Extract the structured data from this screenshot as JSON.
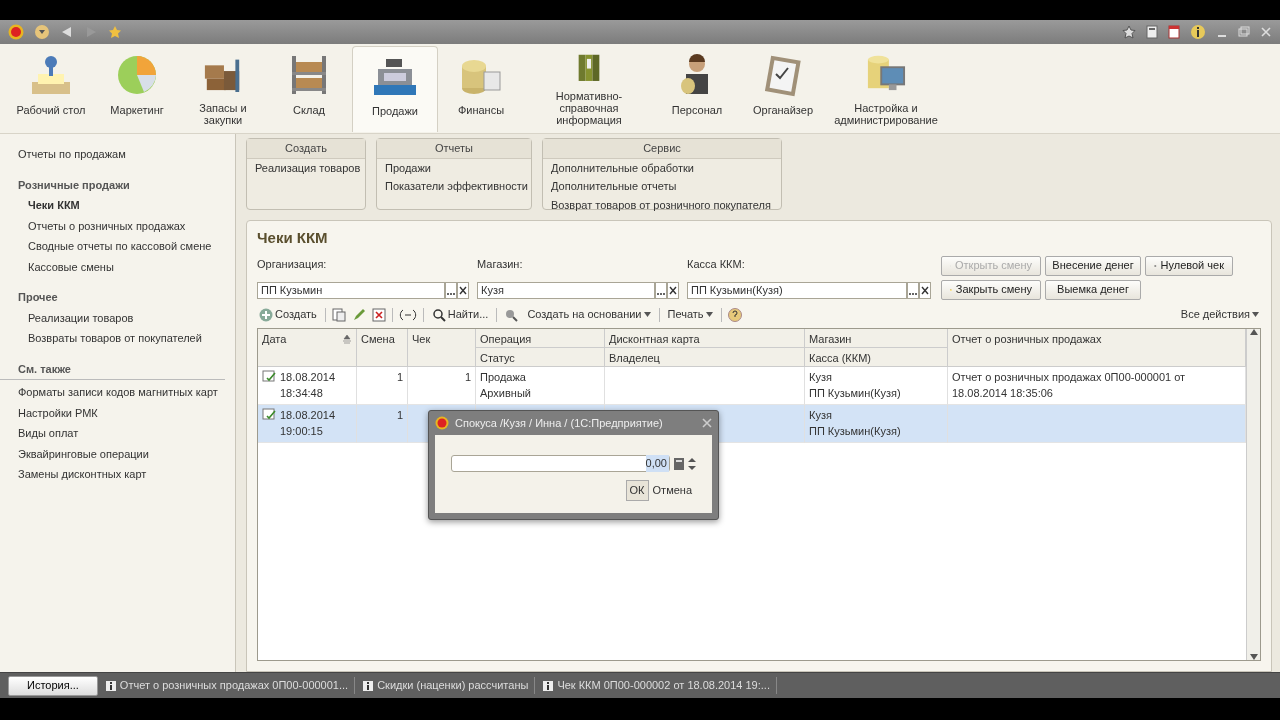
{
  "sections": [
    {
      "label": "Рабочий стол",
      "selected": false
    },
    {
      "label": "Маркетинг",
      "selected": false
    },
    {
      "label": "Запасы и закупки",
      "selected": false
    },
    {
      "label": "Склад",
      "selected": false
    },
    {
      "label": "Продажи",
      "selected": true
    },
    {
      "label": "Финансы",
      "selected": false
    },
    {
      "label": "Нормативно-справочная информация",
      "selected": false
    },
    {
      "label": "Персонал",
      "selected": false
    },
    {
      "label": "Органайзер",
      "selected": false
    },
    {
      "label": "Настройка и администрирование",
      "selected": false
    }
  ],
  "sidebar": {
    "items": [
      {
        "kind": "link",
        "label": "Отчеты по продажам",
        "selected": false
      },
      {
        "kind": "heading",
        "label": "Розничные продажи"
      },
      {
        "kind": "sub",
        "label": "Чеки ККМ",
        "selected": true
      },
      {
        "kind": "sub",
        "label": "Отчеты о розничных продажах",
        "selected": false
      },
      {
        "kind": "sub",
        "label": "Сводные отчеты по кассовой смене",
        "selected": false
      },
      {
        "kind": "sub",
        "label": "Кассовые смены",
        "selected": false
      },
      {
        "kind": "heading",
        "label": "Прочее"
      },
      {
        "kind": "sub",
        "label": "Реализации товаров",
        "selected": false
      },
      {
        "kind": "sub",
        "label": "Возвраты товаров от покупателей",
        "selected": false
      },
      {
        "kind": "see_also",
        "label": "См. также"
      },
      {
        "kind": "link",
        "label": "Форматы записи кодов магнитных карт",
        "selected": false
      },
      {
        "kind": "link",
        "label": "Настройки РМК",
        "selected": false
      },
      {
        "kind": "link",
        "label": "Виды оплат",
        "selected": false
      },
      {
        "kind": "link",
        "label": "Эквайринговые операции",
        "selected": false
      },
      {
        "kind": "link",
        "label": "Замены дисконтных карт",
        "selected": false
      }
    ]
  },
  "command_panels": [
    {
      "title": "Создать",
      "items": [
        "Реализация товаров"
      ]
    },
    {
      "title": "Отчеты",
      "items": [
        "Продажи",
        "Показатели эффективности"
      ]
    },
    {
      "title": "Сервис",
      "items": [
        "Дополнительные обработки",
        "Дополнительные отчеты",
        "Возврат товаров от розничного покупателя"
      ]
    }
  ],
  "form": {
    "title": "Чеки ККМ",
    "fields": [
      {
        "label": "Организация:",
        "value": "ПП Кузьмин"
      },
      {
        "label": "Магазин:",
        "value": "Кузя"
      },
      {
        "label": "Касса ККМ:",
        "value": "ПП Кузьмин(Кузя)"
      }
    ],
    "buttons": [
      {
        "label": "Открыть смену",
        "disabled": true
      },
      {
        "label": "Внесение денег",
        "disabled": false
      },
      {
        "label": "Нулевой чек",
        "disabled": false
      },
      {
        "label": "Закрыть смену",
        "disabled": false
      },
      {
        "label": "Выемка денег",
        "disabled": false
      }
    ]
  },
  "toolbar": {
    "create": "Создать",
    "find": "Найти...",
    "based_on": "Создать на основании",
    "print": "Печать",
    "all_actions": "Все действия"
  },
  "table": {
    "columns": [
      {
        "top": "Дата"
      },
      {
        "top": "Смена"
      },
      {
        "top": "Чек"
      },
      {
        "top": "Операция",
        "bottom": "Статус"
      },
      {
        "top": "Дисконтная карта",
        "bottom": "Владелец"
      },
      {
        "top": "Магазин",
        "bottom": "Касса (ККМ)"
      },
      {
        "top": "Отчет о розничных продажах"
      }
    ],
    "rows": [
      {
        "selected": false,
        "date": "18.08.2014",
        "time": "18:34:48",
        "shift": "1",
        "check": "1",
        "operation": "Продажа",
        "status": "Архивный",
        "shop": "Кузя",
        "register": "ПП Кузьмин(Кузя)",
        "report": "Отчет о розничных продажах 0П00-000001 от 18.08.2014 18:35:06"
      },
      {
        "selected": true,
        "date": "18.08.2014",
        "time": "19:00:15",
        "shift": "1",
        "shop": "Кузя",
        "register": "ПП Кузьмин(Кузя)"
      }
    ]
  },
  "dialog": {
    "title": "Спокуса /Кузя / Инна / (1С:Предприятие)",
    "value": "0,00",
    "buttons": [
      {
        "label": "ОК",
        "selected": true
      },
      {
        "label": "Отмена",
        "selected": false
      }
    ]
  },
  "status_bar": {
    "history": "История...",
    "messages": [
      "Отчет о розничных продажах 0П00-000001...",
      "Скидки (наценки) рассчитаны",
      "Чек ККМ 0П00-000002 от 18.08.2014 19:..."
    ]
  }
}
